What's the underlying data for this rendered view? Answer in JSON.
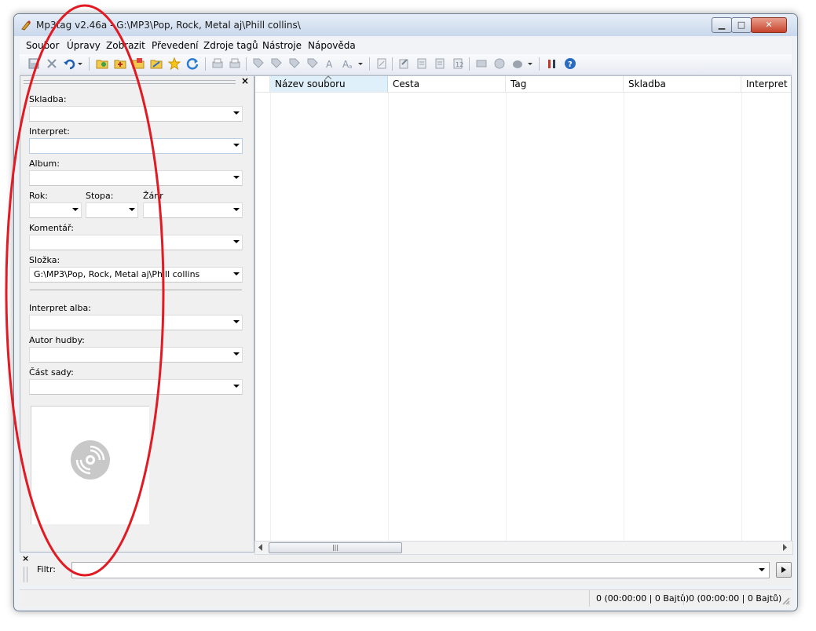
{
  "window": {
    "title": "Mp3tag v2.46a  -  G:\\MP3\\Pop, Rock, Metal aj\\Phill collins\\",
    "buttons": {
      "minimize": "▁",
      "maximize": "□",
      "close": "✕"
    }
  },
  "menubar": {
    "items": [
      "Soubor",
      "Úpravy",
      "Zobrazit",
      "Převedení",
      "Zdroje tagů",
      "Nástroje",
      "Nápověda"
    ]
  },
  "toolbar": {
    "icons": [
      "save-icon",
      "remove-tag-icon",
      "undo-icon",
      "undo-dropdown-icon",
      "change-directory-icon",
      "add-directory-icon",
      "open-folder-icon",
      "favorite-directory-icon",
      "star-icon",
      "refresh-icon",
      "print-icon",
      "print-preview-icon",
      "tag-filename-icon",
      "filename-tag-icon",
      "filename-filename-icon",
      "text-file-tag-icon",
      "case-conversion-icon",
      "replace-icon",
      "replace-dropdown-icon",
      "edit-icon",
      "export-icon",
      "actions-icon",
      "actions-quick-icon",
      "autonumbering-icon",
      "playlist-icon",
      "web-source-icon",
      "tag-source-icon",
      "tag-source-dropdown-icon",
      "options-icon",
      "help-icon"
    ]
  },
  "tag_panel": {
    "close_label": "×",
    "fields": {
      "title_label": "Skladba:",
      "title_value": "",
      "artist_label": "Interpret:",
      "artist_value": "",
      "album_label": "Album:",
      "album_value": "",
      "year_label": "Rok:",
      "year_value": "",
      "track_label": "Stopa:",
      "track_value": "",
      "genre_label": "Žánr",
      "genre_value": "",
      "comment_label": "Komentář:",
      "comment_value": "",
      "directory_label": "Složka:",
      "directory_value": "G:\\MP3\\Pop, Rock, Metal aj\\Phill collins",
      "album_artist_label": "Interpret alba:",
      "album_artist_value": "",
      "composer_label": "Autor hudby:",
      "composer_value": "",
      "discnumber_label": "Část sady:",
      "discnumber_value": ""
    }
  },
  "file_list": {
    "columns": [
      "Název souboru",
      "Cesta",
      "Tag",
      "Skladba",
      "Interpret"
    ],
    "sorted_column": "Název souboru",
    "rows": [],
    "hscroll_grip": "|||"
  },
  "filter": {
    "close_label": "×",
    "label": "Filtr:",
    "value": ""
  },
  "status": {
    "selected": "0 (00:00:00 | 0 Bajtů)",
    "total": "0 (00:00:00 | 0 Bajtů)"
  },
  "colors": {
    "annotation": "#e01b24",
    "header_highlight": "#dff0fa"
  }
}
